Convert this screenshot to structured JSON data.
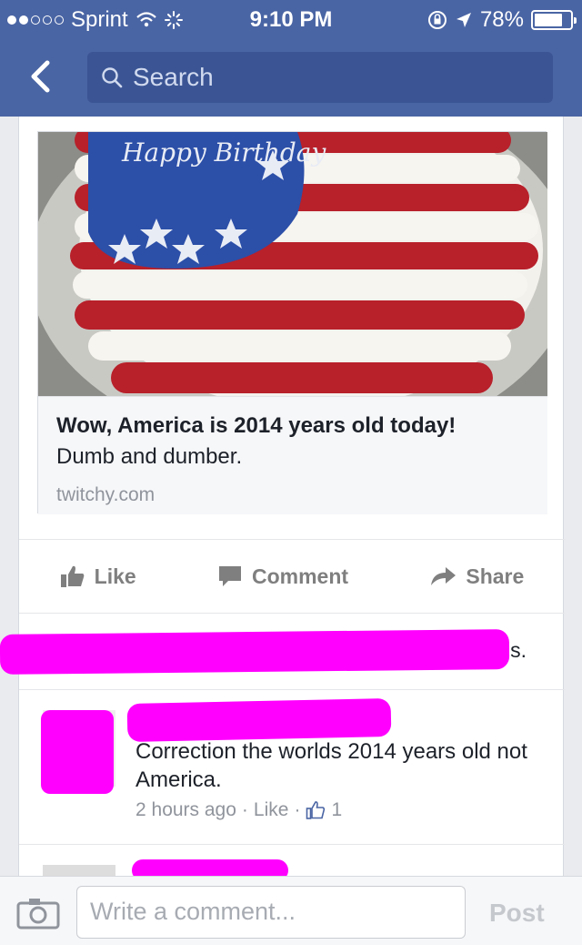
{
  "status_bar": {
    "carrier": "Sprint",
    "time": "9:10 PM",
    "battery": "78%",
    "battery_level": 0.78
  },
  "nav": {
    "search_placeholder": "Search"
  },
  "post": {
    "image_text": "Happy Birthday",
    "link_title": "Wow, America is 2014 years old today!",
    "link_description": "Dumb and dumber.",
    "link_domain": "twitchy.com",
    "actions": {
      "like": "Like",
      "comment": "Comment",
      "share": "Share"
    },
    "likes_line_visible": "this."
  },
  "comment": {
    "text": "Correction the worlds 2014 years old not America.",
    "time": "2 hours ago",
    "like_label": "Like",
    "like_count": "1"
  },
  "composer": {
    "placeholder": "Write a comment...",
    "post_label": "Post"
  },
  "colors": {
    "nav_blue": "#4a65a4",
    "redaction_magenta": "#ff00ff"
  }
}
